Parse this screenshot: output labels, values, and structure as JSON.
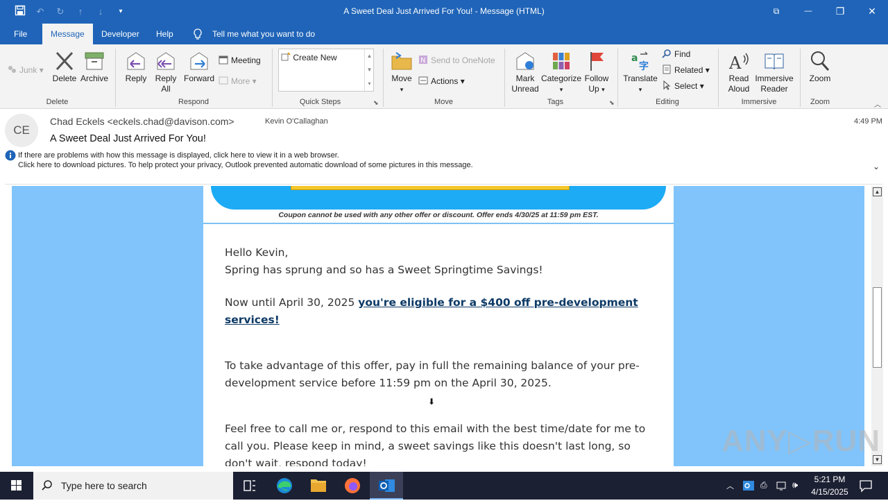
{
  "window": {
    "title": "A Sweet Deal Just Arrived For You!  -  Message (HTML)",
    "controls": {
      "ribbon_display": "⧉",
      "minimize": "—",
      "restore": "❐",
      "close": "✕"
    }
  },
  "quick_access": {
    "save": "🖫",
    "undo": "↶",
    "redo": "↻",
    "up": "↑",
    "down": "↓",
    "customize": "▾"
  },
  "tabs": [
    {
      "label": "File"
    },
    {
      "label": "Message"
    },
    {
      "label": "Developer"
    },
    {
      "label": "Help"
    }
  ],
  "tell_me": "Tell me what you want to do",
  "ribbon": {
    "delete_group": {
      "junk": "Junk",
      "delete": "Delete",
      "archive": "Archive",
      "label": "Delete"
    },
    "respond_group": {
      "reply": "Reply",
      "reply_all_1": "Reply",
      "reply_all_2": "All",
      "forward": "Forward",
      "meeting": "Meeting",
      "more": "More",
      "label": "Respond"
    },
    "quick_steps": {
      "create_new": "Create New",
      "label": "Quick Steps"
    },
    "move_group": {
      "move": "Move",
      "onenote": "Send to OneNote",
      "actions": "Actions",
      "label": "Move"
    },
    "tags_group": {
      "mark_1": "Mark",
      "mark_2": "Unread",
      "categorize": "Categorize",
      "follow_1": "Follow",
      "follow_2": "Up",
      "label": "Tags"
    },
    "editing_group": {
      "translate": "Translate",
      "find": "Find",
      "related": "Related",
      "select": "Select",
      "label": "Editing"
    },
    "immersive_group": {
      "read_1": "Read",
      "read_2": "Aloud",
      "reader_1": "Immersive",
      "reader_2": "Reader",
      "label": "Immersive"
    },
    "zoom_group": {
      "zoom": "Zoom",
      "label": "Zoom"
    }
  },
  "message": {
    "avatar_initials": "CE",
    "from": "Chad Eckels <eckels.chad@davison.com>",
    "to": "Kevin O'Callaghan",
    "time": "4:49 PM",
    "subject": "A Sweet Deal Just Arrived For You!",
    "info_line_1": "If there are problems with how this message is displayed, click here to view it in a web browser.",
    "info_line_2": "Click here to download pictures. To help protect your privacy, Outlook prevented automatic download of some pictures in this message."
  },
  "email_body": {
    "coupon_note": "Coupon cannot be used with any other offer or discount. Offer ends 4/30/25 at 11:59 pm EST.",
    "greeting": "Hello Kevin,",
    "line_spring": "Spring has sprung and so has a Sweet Springtime Savings!",
    "offer_prefix": "Now until  April 30, 2025 ",
    "offer_link": "you're eligible for a $400 off pre-development services! ",
    "para_take": "To take advantage of this offer, pay in full the remaining balance of your pre-development service before 11:59 pm on the April 30, 2025.",
    "para_call": "Feel free to call me or, respond to this email with the best time/date for me to call you. Please keep in mind, a sweet savings like this doesn't last long, so don't wait, respond  today!"
  },
  "watermark": "ANY▷RUN",
  "taskbar": {
    "search_placeholder": "Type here to search",
    "time": "5:21 PM",
    "date": "4/15/2025"
  },
  "colors": {
    "accent": "#1f64b8",
    "body_bg": "#80c4fb",
    "banner": "#1dabf5",
    "link": "#0d3a66"
  }
}
